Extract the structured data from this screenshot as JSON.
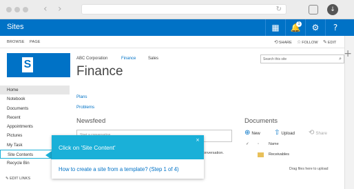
{
  "suite": {
    "title": "Sites",
    "notification_count": "1",
    "help": "?"
  },
  "ribbon": {
    "tabs": [
      "BROWSE",
      "PAGE"
    ],
    "share": "SHARE",
    "follow": "FOLLOW",
    "edit": "EDIT"
  },
  "topnav": [
    "ABC Corporation",
    "Finance",
    "Sales"
  ],
  "site_title": "Finance",
  "search": {
    "placeholder": "Search this site"
  },
  "quicklaunch": [
    "Home",
    "Notebook",
    "Documents",
    "Recent",
    "Appointments",
    "Pictures",
    "My Task",
    "Site Contents",
    "Recycle Bin"
  ],
  "edit_links": "EDIT LINKS",
  "main": {
    "links": [
      "Plans",
      "Problems"
    ],
    "newsfeed_title": "Newsfeed",
    "newsfeed_placeholder": "Start a conversation",
    "conversation_text": "onversation."
  },
  "documents": {
    "title": "Documents",
    "new_label": "New",
    "upload_label": "Upload",
    "share_label": "Share",
    "column_name": "Name",
    "rows": [
      "Receivables"
    ],
    "drag_hint": "Drag files here to upload"
  },
  "callout": {
    "title": "Click on 'Site Content'",
    "link": "How to create a site from a template? (Step 1 of 4)"
  },
  "colors": {
    "accent": "#0072c6",
    "callout": "#1ab0d8"
  }
}
